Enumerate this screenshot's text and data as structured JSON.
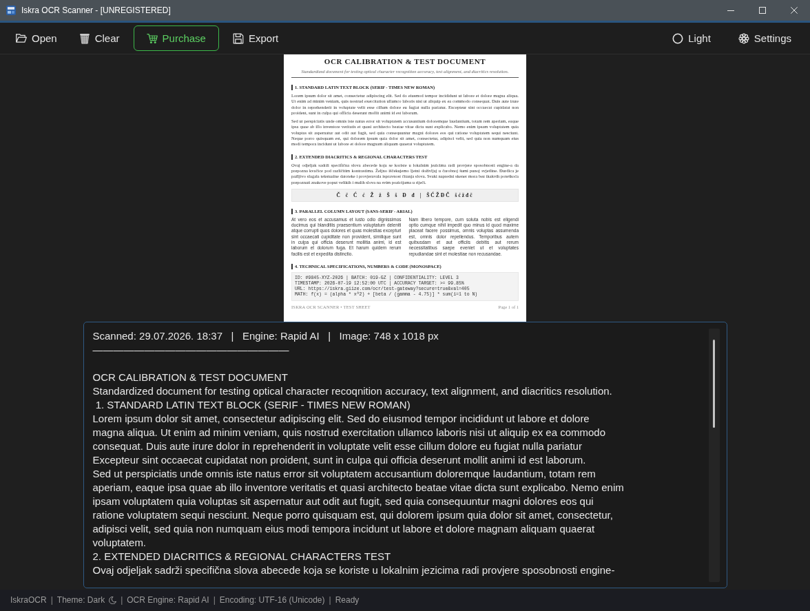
{
  "window": {
    "title": "Iskra OCR Scanner - [UNREGISTERED]"
  },
  "toolbar": {
    "left": [
      {
        "kind": "open",
        "label": "Open",
        "highlighted": false
      },
      {
        "kind": "clear",
        "label": "Clear",
        "highlighted": false
      },
      {
        "kind": "purchase",
        "label": "Purchase",
        "highlighted": true
      },
      {
        "kind": "export",
        "label": "Export",
        "highlighted": false
      }
    ],
    "right": [
      {
        "kind": "theme",
        "label": "Light",
        "highlighted": false
      },
      {
        "kind": "settings",
        "label": "Settings",
        "highlighted": false
      }
    ]
  },
  "document": {
    "title": "OCR CALIBRATION & TEST DOCUMENT",
    "subtitle": "Standardized document for testing optical character recognition accuracy, text alignment, and diacritics resolution.",
    "sections": [
      {
        "heading": "1. STANDARD LATIN TEXT BLOCK (SERIF - TIMES NEW ROMAN)",
        "blocks": [
          {
            "kind": "paragraph",
            "text": "Lorem ipsum dolor sit amet, consectetur adipiscing elit. Sed do eiusmod tempor incididunt ut labore et dolore magna aliqua. Ut enim ad minim veniam, quis nostrud exercitation ullamco laboris nisi ut aliquip ex ea commodo consequat. Duis aute irure dolor in reprehenderit in voluptate velit esse cillum dolore eu fugiat nulla pariatur. Excepteur sint occaecat cupidatat non proident, sunt in culpa qui officia deserunt mollit animi id est laborum."
          },
          {
            "kind": "paragraph",
            "text": "Sed ut perspiciatis unde omnis iste natus error sit voluptatem accusantium doloremque laudantium, totam rem aperiam, eaque ipsa quae ab illo inventore veritatis et quasi architecto beatae vitae dicta sunt explicabo. Nemo enim ipsam voluptatem quia voluptas sit aspernatur aut odit aut fugit, sed quia consequuntur magni dolores eos qui ratione voluptatem sequi nesciunt. Neque porro quisquam est, qui dolorem ipsum quia dolor sit amet, consectetur, adipisci velit, sed quia non numquam eius modi tempora incidunt ut labore et dolore magnam aliquam quaerat voluptatem."
          }
        ]
      },
      {
        "heading": "2. EXTENDED DIACRITICS & REGIONAL CHARACTERS TEST",
        "blocks": [
          {
            "kind": "paragraph",
            "text": "Ovaj odjeljak sadrži specifična slova abecede koja se koriste u lokalnim jezicima radi provjere sposobnosti engine-a da prepozna kvačice pod različitim kontrastima. Željno iščekujemo ljetni doživljaj u čarobnoj šumi punoj svjetline. Đurđica je pažljivo slagala tekstualne datoteke i provjeravala ispravnost čitanja slova. Svaki napredni skener mora bez ikakvih poteškoća prepoznati znakove poput velikih i malih slova na svim pozicijama u riječi."
          },
          {
            "kind": "charset",
            "text": "Č č Ć ć Ž ž Š š Đ đ | ŠĆŽĐČ šćžđč"
          }
        ]
      },
      {
        "heading": "3. PARALLEL COLUMN LAYOUT (SANS-SERIF - ARIAL)",
        "blocks": [
          {
            "kind": "columns",
            "columns": [
              "At vero eos et accusamus et iusto odio dignissimos ducimus qui blanditiis praesentium voluptatum deleniti atque corrupti quos dolores et quas molestias excepturi sint occaecati cupiditate non provident, similique sunt in culpa qui officia deserunt mollitia animi, id est laborum et dolorum fuga. Et harum quidem rerum facilis est et expedita distinctio.",
              "Nam libero tempore, cum soluta nobis est eligendi optio cumque nihil impedit quo minus id quod maxime placeat facere possimus, omnis voluptas assumenda est, omnis dolor repellendus. Temporibus autem quibusdam et aut officiis debitis aut rerum necessitatibus saepe eveniet ut et voluptates repudiandae sint et molestiae non recusandae."
            ]
          }
        ]
      },
      {
        "heading": "4. TECHNICAL SPECIFICATIONS, NUMBERS & CODE (MONOSPACE)",
        "blocks": [
          {
            "kind": "code",
            "lines": [
              "ID: #9845-XYZ-2026 | BATCH: 019-GZ | CONFIDENTIALITY: LEVEL 3",
              "TIMESTAMP: 2026-07-19 12:52:00 UTC | ACCURACY TARGET: >= 99.85%",
              "URL: https://iskra.giize.com/ocr/test-gateway?secure=true&val=405",
              "MATH: f(x) = (alpha * x^2) + [beta / (gamma - 4.75)] * sum(i=1 to N)"
            ]
          }
        ]
      }
    ],
    "footer": {
      "left": "ISKRA OCR SCANNER • TEST SHEET",
      "right": "Page 1 of 1"
    }
  },
  "ocr_output": {
    "info": "Scanned: 29.07.2026. 18:37   |   Engine: Rapid AI   |   Image: 748 x 1018 px",
    "rule": "———————————————————",
    "lines": [
      "OCR CALIBRATION & TEST DOCUMENT",
      "Standardized document for testing optical character recoqnition accuracy, text alignment, and diacritics resolution.",
      " 1. STANDARD LATIN TEXT BLOCK (SERIF - TIMES NEW ROMAN)",
      "Lorem ipsum dolor sit amet, consectetur adipiscing elit. Sed do eiusmod tempor incididunt ut labore et dolore",
      "magna aliqua. Ut enim ad minim veniam, quis nostrud exercitation ullamco laboris nisi ut aliquip ex ea commodo",
      "consequat. Duis aute irure dolor in reprehenderit in voluptate velit esse cillum dolore eu fugiat nulla pariatur",
      "Excepteur sint occaecat cupidatat non proident, sunt in culpa qui officia deserunt mollit animi id est laborum.",
      "Sed ut perspiciatis unde omnis iste natus error sit voluptatem accusantium doloremque laudantium, totam rem",
      "aperiam, eaque ipsa quae ab illo inventore veritatis et quasi architecto beatae vitae dicta sunt explicabo. Nemo enim",
      "ipsam voluptatem quia voluptas sit aspernatur aut odit aut fugit, sed quia consequuntur magni dolores eos qui",
      "ratione voluptatem sequi nesciunt. Neque porro quisquam est, qui dolorem ipsum quia dolor sit amet, consectetur,",
      "adipisci velit, sed quia non numquam eius modi tempora incidunt ut labore et dolore magnam aliquam quaerat",
      "voluptatem.",
      "2. EXTENDED DIACRITICS & REGIONAL CHARACTERS TEST",
      "Ovaj odjeljak sadrži specifična slova abecede koja se koriste u lokalnim jezicima radi provjere sposobnosti engine-"
    ]
  },
  "status_bar": {
    "items": [
      {
        "kind": "label",
        "text": "IskraOCR"
      },
      {
        "kind": "separator",
        "text": "|"
      },
      {
        "kind": "theme",
        "text": "Theme: Dark"
      },
      {
        "kind": "separator",
        "text": "|"
      },
      {
        "kind": "label",
        "text": "OCR Engine: Rapid AI"
      },
      {
        "kind": "separator",
        "text": "|"
      },
      {
        "kind": "label",
        "text": "Encoding: UTF-16 (Unicode)"
      },
      {
        "kind": "separator",
        "text": "|"
      },
      {
        "kind": "label",
        "text": "Ready"
      }
    ]
  }
}
